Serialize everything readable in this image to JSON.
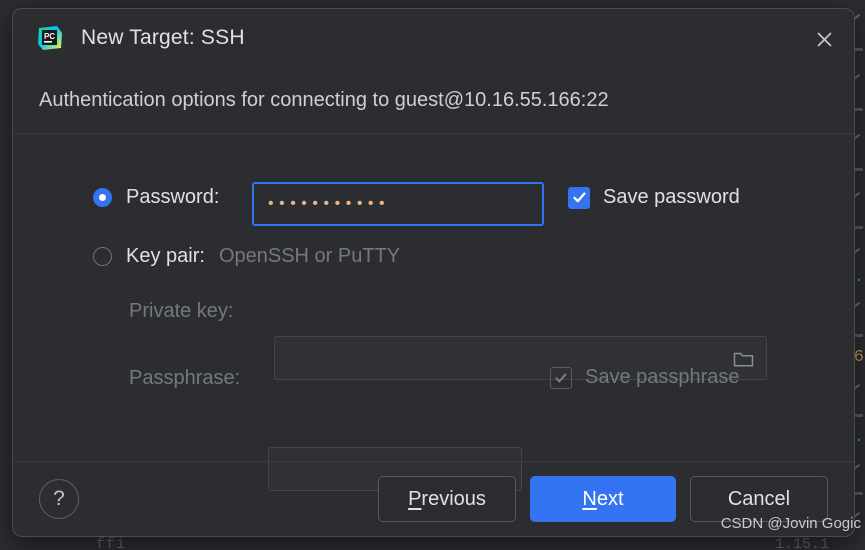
{
  "dialog": {
    "title": "New Target: SSH",
    "app_icon": "pycharm-icon",
    "close_icon": "close-icon",
    "subtitle": "Authentication options for connecting to guest@10.16.55.166:22"
  },
  "auth": {
    "password_option": {
      "selected": true,
      "label": "Password:",
      "value": "•••••••••••",
      "placeholder": ""
    },
    "save_password": {
      "label": "Save password",
      "checked": true
    },
    "keypair_option": {
      "selected": false,
      "label": "Key pair:",
      "hint": "OpenSSH or PuTTY"
    },
    "private_key": {
      "label": "Private key:",
      "value": "",
      "browse_icon": "folder-icon"
    },
    "passphrase": {
      "label": "Passphrase:",
      "value": ""
    },
    "save_passphrase": {
      "label": "Save passphrase",
      "checked": true
    }
  },
  "footer": {
    "help_label": "?",
    "previous_label": "Previous",
    "previous_mnemonic": "P",
    "previous_rest": "revious",
    "next_label": "Next",
    "next_mnemonic": "N",
    "next_rest": "ext",
    "cancel_label": "Cancel"
  },
  "watermark": {
    "text": "CSDN @Jovin Gogic"
  },
  "background": {
    "bottom_left_fragment": "ffi",
    "bottom_right_fragment": "1.15.1"
  },
  "colors": {
    "accent": "#3574f0",
    "dialog_bg": "#2b2d30",
    "window_bg": "#1e1f22",
    "text": "#dfe1e5",
    "muted_text": "#75787d",
    "border": "#4e5157",
    "password_dot": "#e8b586"
  }
}
